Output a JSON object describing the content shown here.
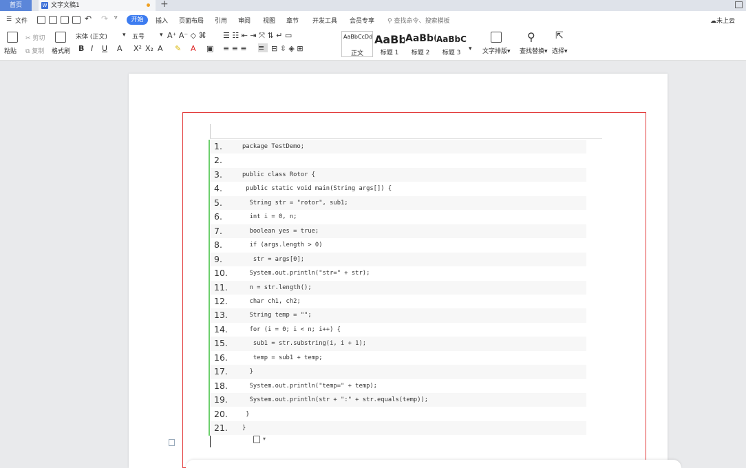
{
  "titlebar": {
    "home_tab": "首页",
    "doc_tab": "文字文稿1",
    "new_tab": "+"
  },
  "menu": {
    "file": "文件",
    "tabs": [
      "开始",
      "插入",
      "页面布局",
      "引用",
      "审阅",
      "视图",
      "章节",
      "开发工具",
      "会员专享"
    ],
    "search": "查找命令、搜索模板",
    "cloud": "未上云"
  },
  "ribbon": {
    "paste": "粘贴",
    "cut": "剪切",
    "copy": "复制",
    "format_painter": "格式刷",
    "font_name": "宋体 (正文)",
    "font_size": "五号",
    "styles": [
      {
        "sample": "AaBbCcDd",
        "name": "正文"
      },
      {
        "sample": "AaBb",
        "name": "标题 1"
      },
      {
        "sample": "AaBb(",
        "name": "标题 2"
      },
      {
        "sample": "AaBbC(",
        "name": "标题 3"
      }
    ],
    "text_layout": "文字排版",
    "find_replace": "查找替换",
    "select": "选择"
  },
  "document": {
    "lines": [
      {
        "num": "1.",
        "code": "package TestDemo;"
      },
      {
        "num": "2.",
        "code": ""
      },
      {
        "num": "3.",
        "code": "public class Rotor {"
      },
      {
        "num": "4.",
        "code": " public static void main(String args[]) {"
      },
      {
        "num": "5.",
        "code": "  String str = \"rotor\", sub1;"
      },
      {
        "num": "6.",
        "code": "  int i = 0, n;"
      },
      {
        "num": "7.",
        "code": "  boolean yes = true;"
      },
      {
        "num": "8.",
        "code": "  if (args.length > 0)"
      },
      {
        "num": "9.",
        "code": "   str = args[0];"
      },
      {
        "num": "10.",
        "code": "  System.out.println(\"str=\" + str);"
      },
      {
        "num": "11.",
        "code": "  n = str.length();"
      },
      {
        "num": "12.",
        "code": "  char ch1, ch2;"
      },
      {
        "num": "13.",
        "code": "  String temp = \"\";"
      },
      {
        "num": "14.",
        "code": "  for (i = 0; i < n; i++) {"
      },
      {
        "num": "15.",
        "code": "   sub1 = str.substring(i, i + 1);"
      },
      {
        "num": "16.",
        "code": "   temp = sub1 + temp;"
      },
      {
        "num": "17.",
        "code": "  }"
      },
      {
        "num": "18.",
        "code": "  System.out.println(\"temp=\" + temp);"
      },
      {
        "num": "19.",
        "code": "  System.out.println(str + \":\" + str.equals(temp));"
      },
      {
        "num": "20.",
        "code": " }"
      },
      {
        "num": "21.",
        "code": "}"
      }
    ]
  },
  "colors": {
    "accent": "#3d7cf0",
    "frame": "#e23a3a",
    "code_bar": "#6ccf6c"
  }
}
